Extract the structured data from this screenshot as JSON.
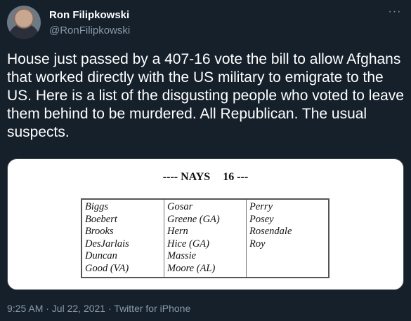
{
  "author": {
    "name": "Ron Filipkowski",
    "handle": "@RonFilipkowski"
  },
  "tweet": {
    "text": "House just passed by a 407-16 vote the bill to allow Afghans that worked directly with the US military to emigrate to the US. Here is a list of the disgusting people who voted to leave them behind to be murdered. All Republican. The usual suspects."
  },
  "image": {
    "heading": "---- NAYS",
    "count": "16 ---",
    "columns": [
      [
        "Biggs",
        "Boebert",
        "Brooks",
        "DesJarlais",
        "Duncan",
        "Good (VA)"
      ],
      [
        "Gosar",
        "Greene (GA)",
        "Hern",
        "Hice (GA)",
        "Massie",
        "Moore (AL)"
      ],
      [
        "Perry",
        "Posey",
        "Rosendale",
        "Roy"
      ]
    ]
  },
  "meta": {
    "time_date": "9:25 AM · Jul 22, 2021",
    "separator": " · ",
    "source": "Twitter for iPhone"
  },
  "icons": {
    "more": "more-options-icon",
    "avatar": "profile-photo"
  },
  "colors": {
    "background": "#15202b",
    "secondary_text": "#8899a6",
    "primary_text": "#ffffff"
  }
}
